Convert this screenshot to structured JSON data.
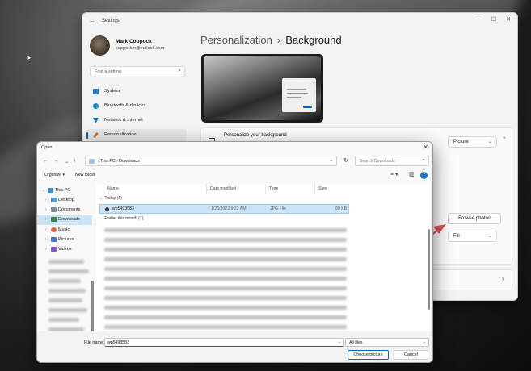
{
  "settings": {
    "title": "Settings",
    "user_name": "Mark Coppock",
    "user_email": "coppockm@outlook.com",
    "search_placeholder": "Find a setting",
    "nav": [
      {
        "label": "System",
        "icon": "monitor-icon",
        "color": "#2b7cd3"
      },
      {
        "label": "Bluetooth & devices",
        "icon": "bluetooth-icon",
        "color": "#1e88d6"
      },
      {
        "label": "Network & internet",
        "icon": "wifi-icon",
        "color": "#1479c6"
      },
      {
        "label": "Personalization",
        "icon": "brush-icon",
        "color": "#d2742a",
        "active": true
      }
    ],
    "breadcrumb_parent": "Personalization",
    "breadcrumb_separator": "›",
    "page_title": "Background",
    "personalize_label": "Personalize your background",
    "personalize_value": "Picture",
    "browse_label": "Browse photos",
    "fit_value": "Fill"
  },
  "dialog": {
    "title": "Open",
    "address": "›  This PC  ›  Downloads",
    "search_placeholder": "Search Downloads",
    "organize_label": "Organize ▾",
    "new_folder_label": "New folder",
    "tree": [
      {
        "label": "This PC",
        "icon": "pc-icon",
        "color": "#3b8ed8"
      },
      {
        "label": "Desktop",
        "icon": "desktop-icon",
        "color": "#4a9be0"
      },
      {
        "label": "Documents",
        "icon": "documents-icon",
        "color": "#7f8c99"
      },
      {
        "label": "Downloads",
        "icon": "downloads-icon",
        "color": "#2f8a4f",
        "selected": true
      },
      {
        "label": "Music",
        "icon": "music-icon",
        "color": "#e25b3b"
      },
      {
        "label": "Pictures",
        "icon": "pictures-icon",
        "color": "#3a7bd5"
      },
      {
        "label": "Videos",
        "icon": "videos-icon",
        "color": "#8b4fd3"
      }
    ],
    "columns": {
      "name": "Name",
      "date": "Date modified",
      "type": "Type",
      "size": "Size"
    },
    "groups": {
      "today": "Today (1)",
      "earlier": "Earlier this month (1)"
    },
    "file": {
      "name": "wp5493583",
      "date": "1/26/2022 9:22 AM",
      "type": "JPG File",
      "size": "89 KB"
    },
    "filename_label": "File name:",
    "filename_value": "wp5493583",
    "filetype_value": "All files",
    "choose_label": "Choose picture",
    "cancel_label": "Cancel"
  },
  "colors": {
    "accent": "#0067c0",
    "selection": "#cce4f7",
    "arrow": "#d9534f"
  }
}
